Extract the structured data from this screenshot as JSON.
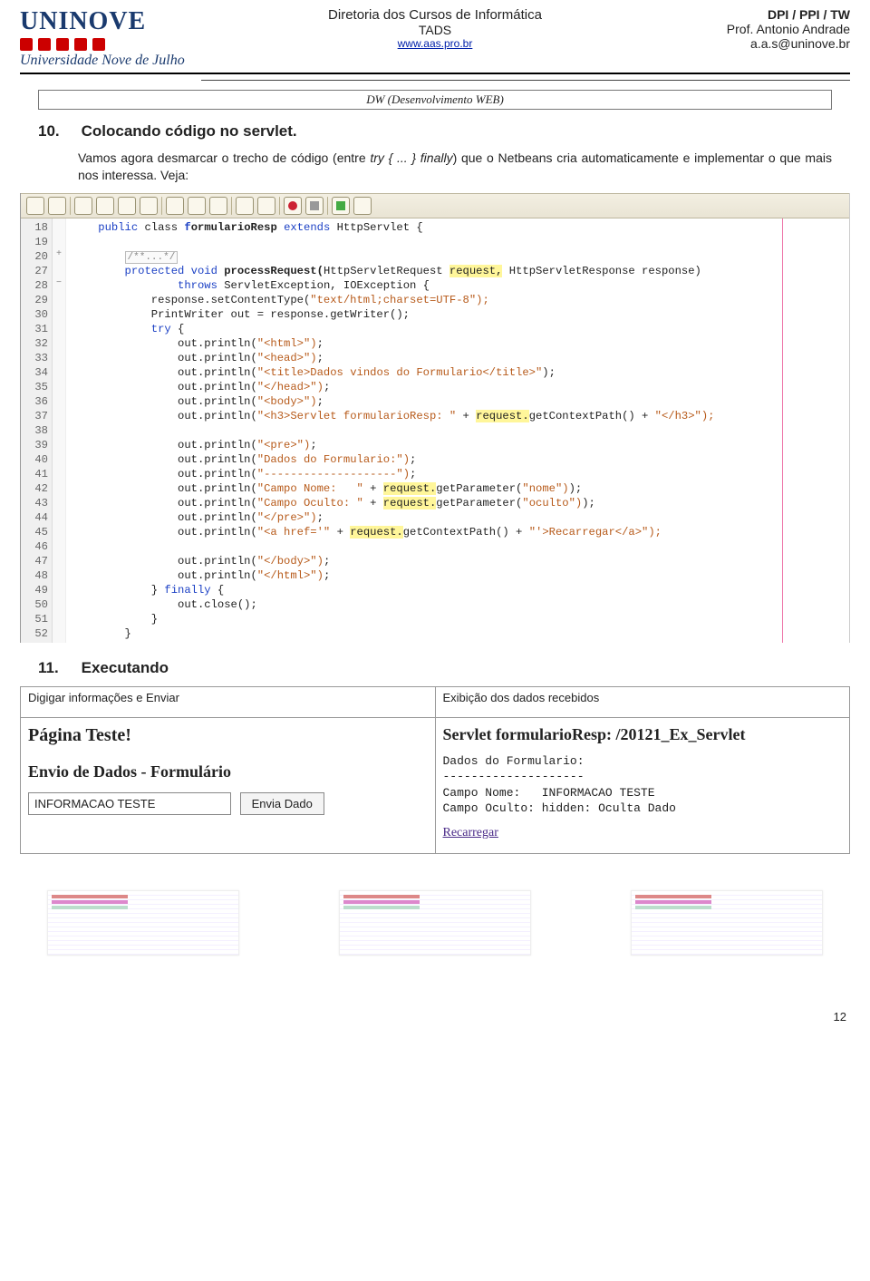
{
  "header": {
    "logo_name": "UNINOVE",
    "logo_sub": "Universidade Nove de Julho",
    "center_line1": "Diretoria dos Cursos de Informática",
    "center_line2": "TADS",
    "center_line3": "www.aas.pro.br",
    "right_line1": "DPI  / PPI / TW",
    "right_line2": "Prof. Antonio Andrade",
    "right_line3": "a.a.s@uninove.br"
  },
  "box_title": "DW (Desenvolvimento WEB)",
  "section10": {
    "num": "10.",
    "title": "Colocando código no servlet.",
    "body_a": "Vamos agora desmarcar o trecho de código (entre ",
    "body_i": "try { ... } finally",
    "body_b": ") que o Netbeans cria automaticamente e implementar o que mais nos interessa. Veja:"
  },
  "gutter": [
    "18",
    "19",
    "20",
    "27",
    "28",
    "29",
    "30",
    "31",
    "32",
    "33",
    "34",
    "35",
    "36",
    "37",
    "38",
    "39",
    "40",
    "41",
    "42",
    "43",
    "44",
    "45",
    "46",
    "47",
    "48",
    "49",
    "50",
    "51",
    "52"
  ],
  "fold": [
    "",
    "",
    "+",
    "",
    "−",
    "",
    "",
    "",
    "",
    "",
    "",
    "",
    "",
    "",
    "",
    "",
    "",
    "",
    "",
    "",
    "",
    "",
    "",
    "",
    "",
    "",
    "",
    "",
    ""
  ],
  "code_lines": [
    {
      "t": "    public class formularioResp extends HttpServlet {",
      "bold_range": [
        17,
        31
      ],
      "kw": [
        [
          4,
          10
        ],
        [
          17,
          17
        ],
        [
          32,
          39
        ]
      ]
    },
    {
      "t": ""
    },
    {
      "t": "        /**...*/",
      "cmt": true
    },
    {
      "t": "        protected void processRequest(HttpServletRequest request, HttpServletResponse response)",
      "bold_range": [
        23,
        37
      ],
      "kw": [
        [
          8,
          17
        ],
        [
          18,
          22
        ]
      ],
      "hi": [
        [
          57,
          64
        ]
      ]
    },
    {
      "t": "                throws ServletException, IOException {",
      "kw": [
        [
          16,
          22
        ]
      ]
    },
    {
      "t": "            response.setContentType(\"text/html;charset=UTF-8\");",
      "str": [
        [
          36,
          62
        ]
      ]
    },
    {
      "t": "            PrintWriter out = response.getWriter();"
    },
    {
      "t": "            try {",
      "kw": [
        [
          12,
          15
        ]
      ]
    },
    {
      "t": "                out.println(\"<html>\");",
      "str": [
        [
          28,
          36
        ]
      ]
    },
    {
      "t": "                out.println(\"<head>\");",
      "str": [
        [
          28,
          36
        ]
      ]
    },
    {
      "t": "                out.println(\"<title>Dados vindos do Formulario</title>\");",
      "str": [
        [
          28,
          70
        ]
      ]
    },
    {
      "t": "                out.println(\"</head>\");",
      "str": [
        [
          28,
          37
        ]
      ]
    },
    {
      "t": "                out.println(\"<body>\");",
      "str": [
        [
          28,
          36
        ]
      ]
    },
    {
      "t": "                out.println(\"<h3>Servlet formularioResp: \" + request.getContextPath() + \"</h3>\");",
      "str": [
        [
          28,
          58
        ],
        [
          88,
          96
        ]
      ],
      "hi": [
        [
          61,
          68
        ]
      ]
    },
    {
      "t": ""
    },
    {
      "t": "                out.println(\"<pre>\");",
      "str": [
        [
          28,
          35
        ]
      ]
    },
    {
      "t": "                out.println(\"Dados do Formulario:\");",
      "str": [
        [
          28,
          50
        ]
      ]
    },
    {
      "t": "                out.println(\"--------------------\");",
      "str": [
        [
          28,
          50
        ]
      ]
    },
    {
      "t": "                out.println(\"Campo Nome:   \" + request.getParameter(\"nome\"));",
      "str": [
        [
          28,
          44
        ],
        [
          68,
          74
        ]
      ],
      "hi": [
        [
          47,
          54
        ]
      ]
    },
    {
      "t": "                out.println(\"Campo Oculto: \" + request.getParameter(\"oculto\"));",
      "str": [
        [
          28,
          44
        ],
        [
          68,
          76
        ]
      ],
      "hi": [
        [
          47,
          54
        ]
      ]
    },
    {
      "t": "                out.println(\"</pre>\");",
      "str": [
        [
          28,
          36
        ]
      ]
    },
    {
      "t": "                out.println(\"<a href='\" + request.getContextPath() + \"'>Recarregar</a>\");",
      "str": [
        [
          28,
          39
        ],
        [
          69,
          89
        ]
      ],
      "hi": [
        [
          42,
          49
        ]
      ]
    },
    {
      "t": ""
    },
    {
      "t": "                out.println(\"</body>\");",
      "str": [
        [
          28,
          37
        ]
      ]
    },
    {
      "t": "                out.println(\"</html>\");",
      "str": [
        [
          28,
          37
        ]
      ]
    },
    {
      "t": "            } finally {",
      "kw": [
        [
          14,
          21
        ]
      ]
    },
    {
      "t": "                out.close();"
    },
    {
      "t": "            }"
    },
    {
      "t": "        }"
    }
  ],
  "section11": {
    "num": "11.",
    "title": "Executando"
  },
  "result": {
    "left_caption": "Digigar informações e Enviar",
    "left_h1": "Página Teste!",
    "left_h2": "Envio de Dados - Formulário",
    "left_input": "INFORMACAO TESTE",
    "left_btn": "Envia Dado",
    "right_caption": "Exibição dos dados recebidos",
    "right_h1": "Servlet formularioResp: /20121_Ex_Servlet",
    "right_pre": "Dados do Formulario:\n--------------------\nCampo Nome:   INFORMACAO TESTE\nCampo Oculto: hidden: Oculta Dado",
    "right_link": "Recarregar"
  },
  "page_num": "12"
}
